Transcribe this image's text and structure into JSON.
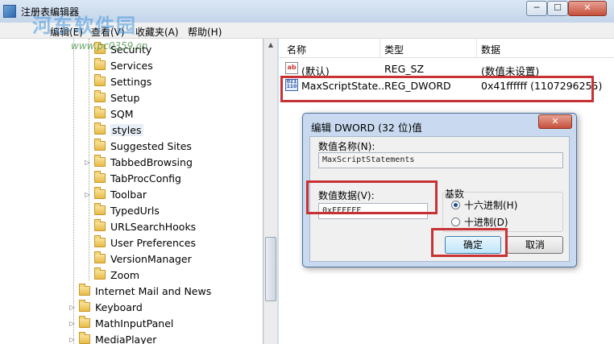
{
  "window": {
    "title": "注册表编辑器",
    "minimize": "─",
    "maximize": "☐",
    "close": "✕"
  },
  "watermark": {
    "text": "河东软件园",
    "url": "www.pc0359.cn"
  },
  "menu": [
    "编辑(E)",
    "查看(V)",
    "收藏夹(A)",
    "帮助(H)"
  ],
  "tree": {
    "items": [
      {
        "label": "Security",
        "expandable": false
      },
      {
        "label": "Services",
        "expandable": false
      },
      {
        "label": "Settings",
        "expandable": false
      },
      {
        "label": "Setup",
        "expandable": false
      },
      {
        "label": "SQM",
        "expandable": false
      },
      {
        "label": "styles",
        "expandable": false,
        "selected": true
      },
      {
        "label": "Suggested Sites",
        "expandable": false
      },
      {
        "label": "TabbedBrowsing",
        "expandable": true
      },
      {
        "label": "TabProcConfig",
        "expandable": false
      },
      {
        "label": "Toolbar",
        "expandable": true
      },
      {
        "label": "TypedUrls",
        "expandable": false
      },
      {
        "label": "URLSearchHooks",
        "expandable": false
      },
      {
        "label": "User Preferences",
        "expandable": false
      },
      {
        "label": "VersionManager",
        "expandable": false
      },
      {
        "label": "Zoom",
        "expandable": false
      },
      {
        "label": "Internet Mail and News",
        "expandable": false
      },
      {
        "label": "Keyboard",
        "expandable": true
      },
      {
        "label": "MathInputPanel",
        "expandable": true
      },
      {
        "label": "MediaPlayer",
        "expandable": true
      }
    ]
  },
  "list": {
    "columns": [
      "名称",
      "类型",
      "数据"
    ],
    "rows": [
      {
        "icon": "string-value-icon",
        "name": "(默认)",
        "type": "REG_SZ",
        "data": "(数值未设置)"
      },
      {
        "icon": "dword-value-icon",
        "name": "MaxScriptState...",
        "type": "REG_DWORD",
        "data": "0x41ffffff (1107296255)"
      }
    ]
  },
  "dialog": {
    "title": "编辑 DWORD (32 位)值",
    "close": "✕",
    "name_label": "数值名称(N):",
    "name_value": "MaxScriptStatements",
    "data_label": "数值数据(V):",
    "data_value": "0xFFFFFF",
    "base_label": "基数",
    "radio_hex": "十六进制(H)",
    "radio_dec": "十进制(D)",
    "selected_base": "hex",
    "ok": "确定",
    "cancel": "取消"
  },
  "colors": {
    "highlight": "#c83234",
    "titlebar": "#c4d5ea",
    "dialog_frame": "#c9daf0"
  }
}
